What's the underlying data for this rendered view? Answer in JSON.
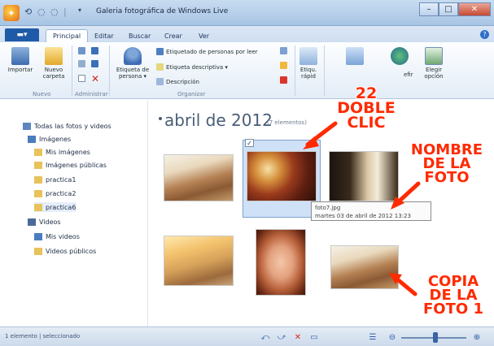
{
  "window": {
    "title": "Galeria fotográfica de Windows Live",
    "minimize": "–",
    "maximize": "□",
    "close": "✕"
  },
  "tabs": {
    "file": "▬▾",
    "items": [
      "Principal",
      "Editar",
      "Buscar",
      "Crear",
      "Ver"
    ]
  },
  "ribbon": {
    "import_label": "Importar",
    "new_folder_label": "Nuevo carpeta",
    "tag_person_label": "Etiqueta de persona ▾",
    "people_tagged": "Etiquetado de personas por leer",
    "descriptive_tag": "Etiqueta descriptiva ▾",
    "description": "Descripción",
    "quick_label": "Etiqu. rápid",
    "set_as_label": "efir",
    "choose_label": "Elegir opción",
    "group_new": "Nuevo",
    "group_manage": "Administrar",
    "group_organize": "Organizar"
  },
  "nav": {
    "all_photos": "Todas las fotos y videos",
    "images": "Imágenes",
    "my_images": "Mis imágenes",
    "public_images": "Imágenes públicas",
    "practica1": "practica1",
    "practica2": "practica2",
    "practica6": "practica6",
    "videos": "Videos",
    "my_videos": "Mis videos",
    "public_videos": "Videos públicos"
  },
  "gallery": {
    "group_title": "abril de 2012",
    "group_count": "(7 elementos)",
    "checkbox_mark": "✓",
    "tooltip_name": "foto7.jpg",
    "tooltip_date": "martes 03 de abril de 2012 13:23"
  },
  "annotations": {
    "double_click": "22\nDOBLE\nCLIC",
    "photo_name": "NOMBRE\nDE LA\nFOTO",
    "copy": "COPIA\nDE LA\nFOTO 1"
  },
  "status": {
    "text": "1 elemento | seleccionado"
  },
  "colors": {
    "accent": "#1f5aa8",
    "annotation": "#ff2a00",
    "selection": "#cfe1f7"
  }
}
